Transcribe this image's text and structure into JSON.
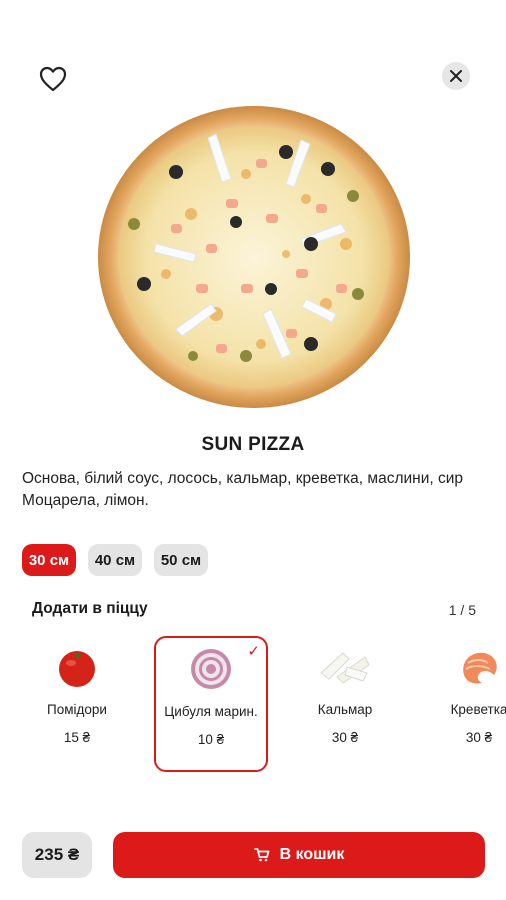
{
  "product": {
    "title": "SUN PIZZA",
    "description": "Основа, білий соус, лосось, кальмар, креветка, маслини, сир Моцарела, лімон."
  },
  "sizes": [
    {
      "label": "30 см",
      "active": true
    },
    {
      "label": "40 см",
      "active": false
    },
    {
      "label": "50 см",
      "active": false
    }
  ],
  "addons": {
    "header": "Додати в піццу",
    "page": "1 / 5",
    "items": [
      {
        "name": "Помідори",
        "price": "15 ₴",
        "icon": "tomato-icon",
        "selected": false
      },
      {
        "name": "Цибуля марин.",
        "price": "10 ₴",
        "icon": "onion-icon",
        "selected": true
      },
      {
        "name": "Кальмар",
        "price": "30 ₴",
        "icon": "squid-icon",
        "selected": false
      },
      {
        "name": "Креветка",
        "price": "30 ₴",
        "icon": "shrimp-icon",
        "selected": false
      }
    ]
  },
  "footer": {
    "price": "235 ₴",
    "cart_label": "В кошик"
  },
  "colors": {
    "accent": "#dd1a1a",
    "chip_bg": "#e4e4e4"
  }
}
